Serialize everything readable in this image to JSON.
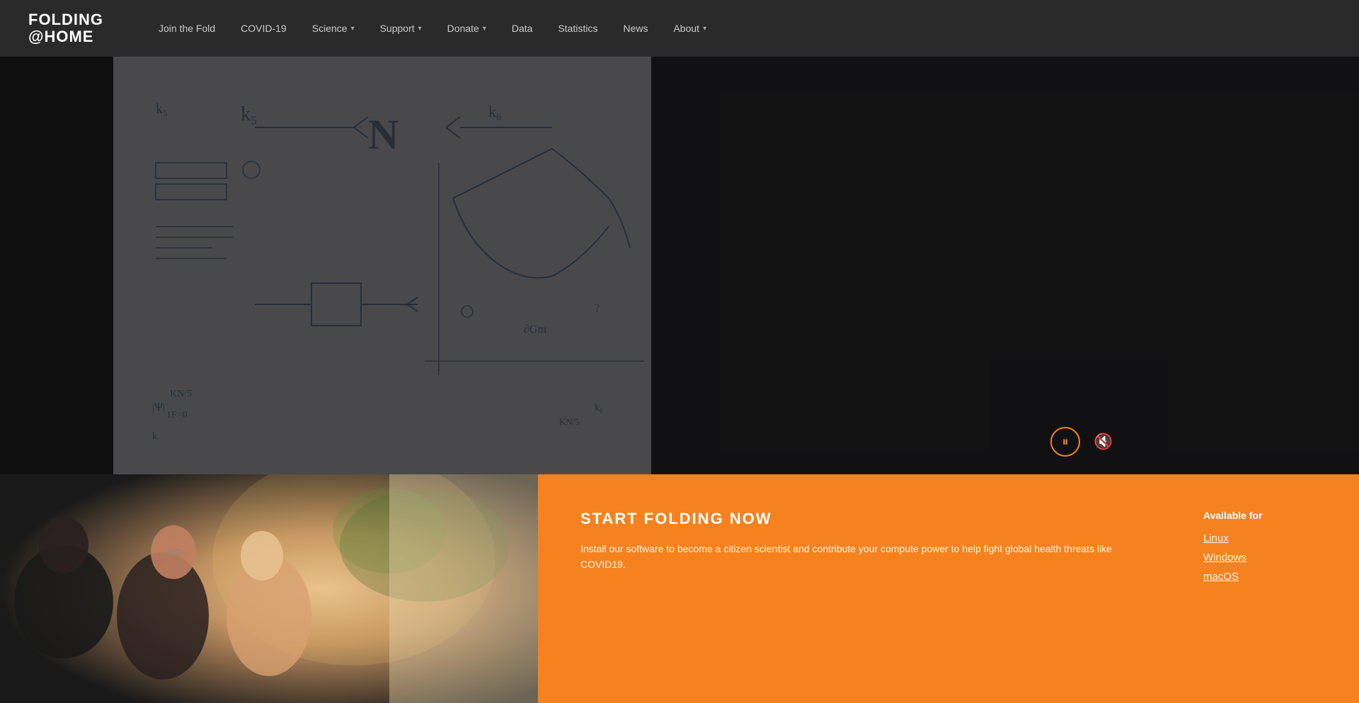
{
  "brand": {
    "line1": "FOLDING",
    "line2": "@HOME"
  },
  "nav": {
    "items": [
      {
        "label": "Join the Fold",
        "has_dropdown": false
      },
      {
        "label": "COVID-19",
        "has_dropdown": false
      },
      {
        "label": "Science",
        "has_dropdown": true
      },
      {
        "label": "Support",
        "has_dropdown": true
      },
      {
        "label": "Donate",
        "has_dropdown": true
      },
      {
        "label": "Data",
        "has_dropdown": false
      },
      {
        "label": "Statistics",
        "has_dropdown": false
      },
      {
        "label": "News",
        "has_dropdown": false
      },
      {
        "label": "About",
        "has_dropdown": true
      }
    ]
  },
  "cta": {
    "title": "START FOLDING NOW",
    "description": "Install our software to become a citizen scientist and contribute your compute power to help fight global health threats like COVID19.",
    "available_label": "Available for",
    "links": [
      {
        "label": "Linux"
      },
      {
        "label": "Windows"
      },
      {
        "label": "macOS"
      }
    ]
  },
  "controls": {
    "pause_icon": "⏸",
    "mute_icon": "🔇"
  }
}
